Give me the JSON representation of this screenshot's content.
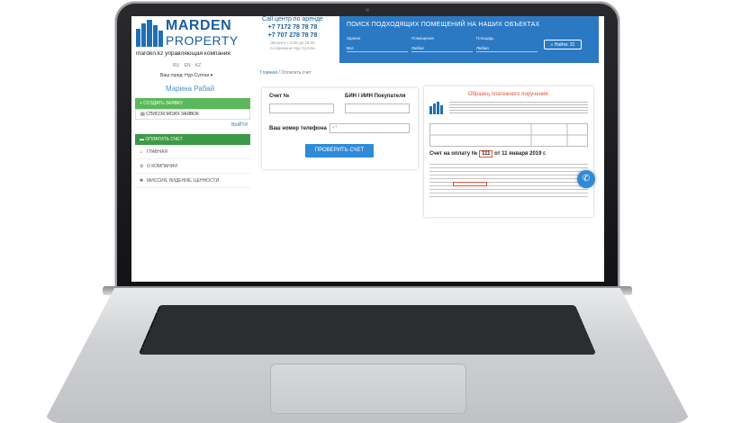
{
  "brand": {
    "name_top": "MARDEN",
    "name_bottom": "PROPERTY",
    "tagline": "marden.kz управляющая компания",
    "logo_color": "#1f6fb5"
  },
  "languages": [
    "RU",
    "EN",
    "KZ"
  ],
  "city": "Ваш город: Нур-Султан ▾",
  "user_name": "Марина Рабай",
  "call_center": {
    "title": "Call центр по аренде",
    "phones": [
      "+7 7172 78 78 78",
      "+7 707 278 78 78"
    ],
    "note_line1": "Звоните с 8:30 до 18:30",
    "note_line2": "по времени Нур-Султан"
  },
  "search": {
    "title": "ПОИСК ПОДХОДЯЩИХ ПОМЕЩЕНИЙ НА НАШИХ ОБЪЕКТАХ",
    "fields": [
      {
        "label": "Здание",
        "value": "Все"
      },
      {
        "label": "Помещение",
        "value": "Любое"
      },
      {
        "label": "Площадь",
        "value": "Любая"
      }
    ],
    "button": "Найти: 31",
    "panel_color": "#2b79c2"
  },
  "breadcrumb": {
    "home": "Главная",
    "separator": "/",
    "current": "Оплатить счет"
  },
  "sidebar": {
    "create_request": "+ СОЗДАТЬ ЗАЯВКУ",
    "my_requests": "СПИСОК МОИХ ЗАЯВОК",
    "logout": "ВЫЙТИ",
    "pay_invoice": "ОПЛАТИТЬ СЧЕТ",
    "menu": [
      {
        "icon": "home-icon",
        "label": "ГЛАВНАЯ"
      },
      {
        "icon": "gear-icon",
        "label": "О КОМПАНИИ"
      },
      {
        "icon": "star-icon",
        "label": "МИССИЯ, ВИДЕНИЕ, ЦЕННОСТИ"
      }
    ]
  },
  "form": {
    "invoice_label": "Счет №",
    "bin_label": "БИН / ИИН Покупателя",
    "phone_label": "Ваш номер телефона",
    "phone_placeholder": "+7",
    "submit": "ПРОВЕРИТЬ СЧЕТ"
  },
  "invoice_sample": {
    "title": "Образец платежного поручения:",
    "due_prefix": "Счет на оплату №",
    "due_number": "111",
    "due_suffix": "от 11 января 2019 г.",
    "accent_color": "#e0533a"
  }
}
